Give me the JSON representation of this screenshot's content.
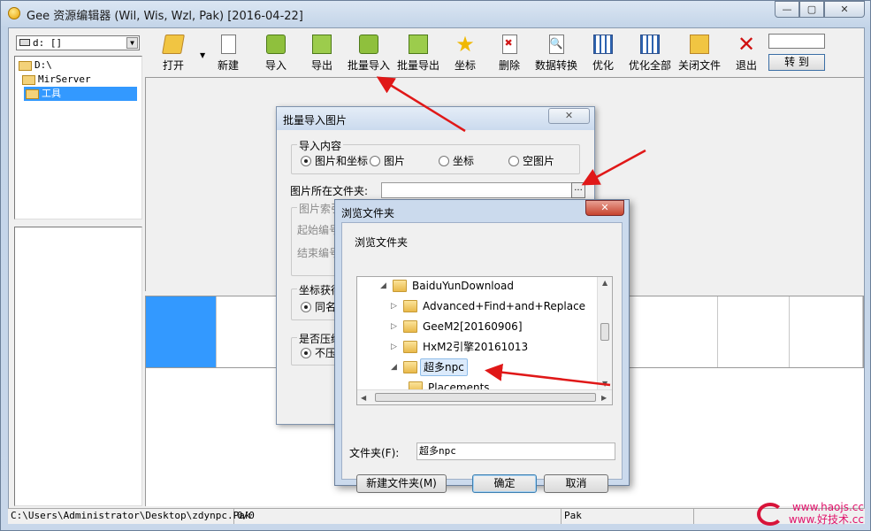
{
  "window": {
    "title": "Gee 资源编辑器 (Wil, Wis, Wzl, Pak) [2016-04-22]",
    "min_glyph": "—",
    "max_glyph": "▢",
    "close_glyph": "✕"
  },
  "sidebar": {
    "drive": "d: []",
    "dirs": [
      "D:\\",
      "MirServer",
      "工具"
    ]
  },
  "toolbar": {
    "items": [
      "打开",
      "新建",
      "导入",
      "导出",
      "批量导入",
      "批量导出",
      "坐标",
      "删除",
      "数据转换",
      "优化",
      "优化全部",
      "关闭文件",
      "退出"
    ],
    "goto_label": "转 到"
  },
  "statusbar": {
    "path": "C:\\Users\\Administrator\\Desktop\\zdynpc.Pak",
    "count": "0/0",
    "type": "Pak"
  },
  "batch_dialog": {
    "title": "批量导入图片",
    "close_glyph": "✕",
    "import_group": "导入内容",
    "options": [
      "图片和坐标",
      "图片",
      "坐标",
      "空图片"
    ],
    "folder_label": "图片所在文件夹:",
    "browse_label": "...",
    "index_group": "图片索引",
    "start_label": "起始编号",
    "end_label": "结束编号",
    "coord_group": "坐标获得",
    "coord_option": "同名",
    "compress_group": "是否压缩",
    "compress_option": "不压"
  },
  "browse_dialog": {
    "title": "浏览文件夹",
    "close_glyph": "✕",
    "prompt": "浏览文件夹",
    "tree": [
      "BaiduYunDownload",
      "Advanced+Find+and+Replace",
      "GeeM2[20160906]",
      "HxM2引擎20161013",
      "超多npc",
      "Placements"
    ],
    "folder_label": "文件夹(F):",
    "folder_value": "超多npc",
    "new_folder_label": "新建文件夹(M)",
    "ok_label": "确定",
    "cancel_label": "取消"
  },
  "watermark": {
    "line1": "www.haojs.cc",
    "line2": "www.好技术.cc"
  },
  "colors": {
    "selection": "#3399ff",
    "annotation_arrow": "#e01818",
    "watermark": "#e0136b"
  }
}
